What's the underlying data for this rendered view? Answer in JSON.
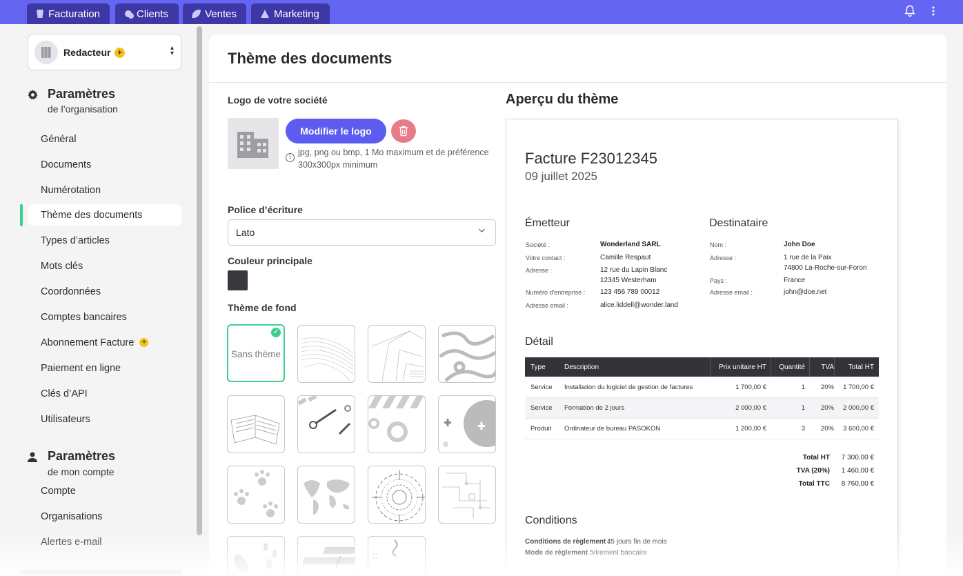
{
  "topnav": {
    "tabs": [
      {
        "label": "Facturation",
        "icon": "invoice-icon"
      },
      {
        "label": "Clients",
        "icon": "clients-icon"
      },
      {
        "label": "Ventes",
        "icon": "sales-icon"
      },
      {
        "label": "Marketing",
        "icon": "marketing-icon"
      }
    ],
    "icons": [
      "bell-icon",
      "more-vertical-icon"
    ]
  },
  "sidebar": {
    "org": {
      "name": "Redacteur",
      "badge": "+"
    },
    "org_section": {
      "title": "Paramètres",
      "subtitle": "de l’organisation"
    },
    "org_items": [
      {
        "label": "Général"
      },
      {
        "label": "Documents"
      },
      {
        "label": "Numérotation"
      },
      {
        "label": "Thème des documents",
        "active": true
      },
      {
        "label": "Types d’articles"
      },
      {
        "label": "Mots clés"
      },
      {
        "label": "Coordonnées"
      },
      {
        "label": "Comptes bancaires"
      },
      {
        "label": "Abonnement Facture",
        "badge": "+"
      },
      {
        "label": "Paiement en ligne"
      },
      {
        "label": "Clés d’API"
      },
      {
        "label": "Utilisateurs"
      }
    ],
    "account_section": {
      "title": "Paramètres",
      "subtitle": "de mon compte"
    },
    "account_items": [
      {
        "label": "Compte"
      },
      {
        "label": "Organisations"
      },
      {
        "label": "Alertes e-mail"
      }
    ]
  },
  "main": {
    "title": "Thème des documents",
    "logo_label": "Logo de votre société",
    "logo_button": "Modifier le logo",
    "logo_hint": "jpg, png ou bmp, 1 Mo maximum et de préférence 300x300px minimum",
    "font_label": "Police d’écriture",
    "font_value": "Lato",
    "color_label": "Couleur principale",
    "color_value": "#38383d",
    "background_label": "Thème de fond",
    "no_theme_label": "Sans thème"
  },
  "preview": {
    "title": "Aperçu du thème",
    "invoice_title": "Facture F23012345",
    "invoice_date": "09 juillet 2025",
    "issuer": {
      "heading": "Émetteur",
      "fields": [
        {
          "key": "Société :",
          "value": "Wonderland SARL"
        },
        {
          "key": "Votre contact :",
          "value": "Camille Respaut"
        },
        {
          "key": "Adresse :",
          "value": "12 rue du Lapin Blanc",
          "value2": "12345 Westerham"
        },
        {
          "key": "Numéro d'entreprise :",
          "value": "123 456 789 00012"
        },
        {
          "key": "Adresse email :",
          "value": "alice.liddell@wonder.land"
        }
      ]
    },
    "recipient": {
      "heading": "Destinataire",
      "fields": [
        {
          "key": "Nom :",
          "value": "John Doe"
        },
        {
          "key": "Adresse :",
          "value": "1 rue de la Paix",
          "value2": "74800 La-Roche-sur-Foron"
        },
        {
          "key": "Pays :",
          "value": "France"
        },
        {
          "key": "Adresse email :",
          "value": "john@doe.net"
        }
      ]
    },
    "detail_heading": "Détail",
    "table": {
      "headers": [
        "Type",
        "Description",
        "Prix unitaire HT",
        "Quantité",
        "TVA",
        "Total HT"
      ],
      "rows": [
        [
          "Service",
          "Installation du logiciel de gestion de factures",
          "1 700,00 €",
          "1",
          "20%",
          "1 700,00 €"
        ],
        [
          "Service",
          "Formation de 2 jours",
          "2 000,00 €",
          "1",
          "20%",
          "2 000,00 €"
        ],
        [
          "Produit",
          "Ordinateur de bureau PASOKON",
          "1 200,00 €",
          "3",
          "20%",
          "3 600,00 €"
        ]
      ]
    },
    "totals": [
      {
        "label": "Total HT",
        "value": "7 300,00 €"
      },
      {
        "label": "TVA (20%)",
        "value": "1 460,00 €"
      },
      {
        "label": "Total TTC",
        "value": "8 760,00 €"
      }
    ],
    "conditions_heading": "Conditions",
    "conditions": [
      {
        "label": "Conditions de règlement :",
        "value": "45 jours fin de mois"
      },
      {
        "label": "Mode de règlement :",
        "value": "Virement bancaire"
      }
    ]
  }
}
